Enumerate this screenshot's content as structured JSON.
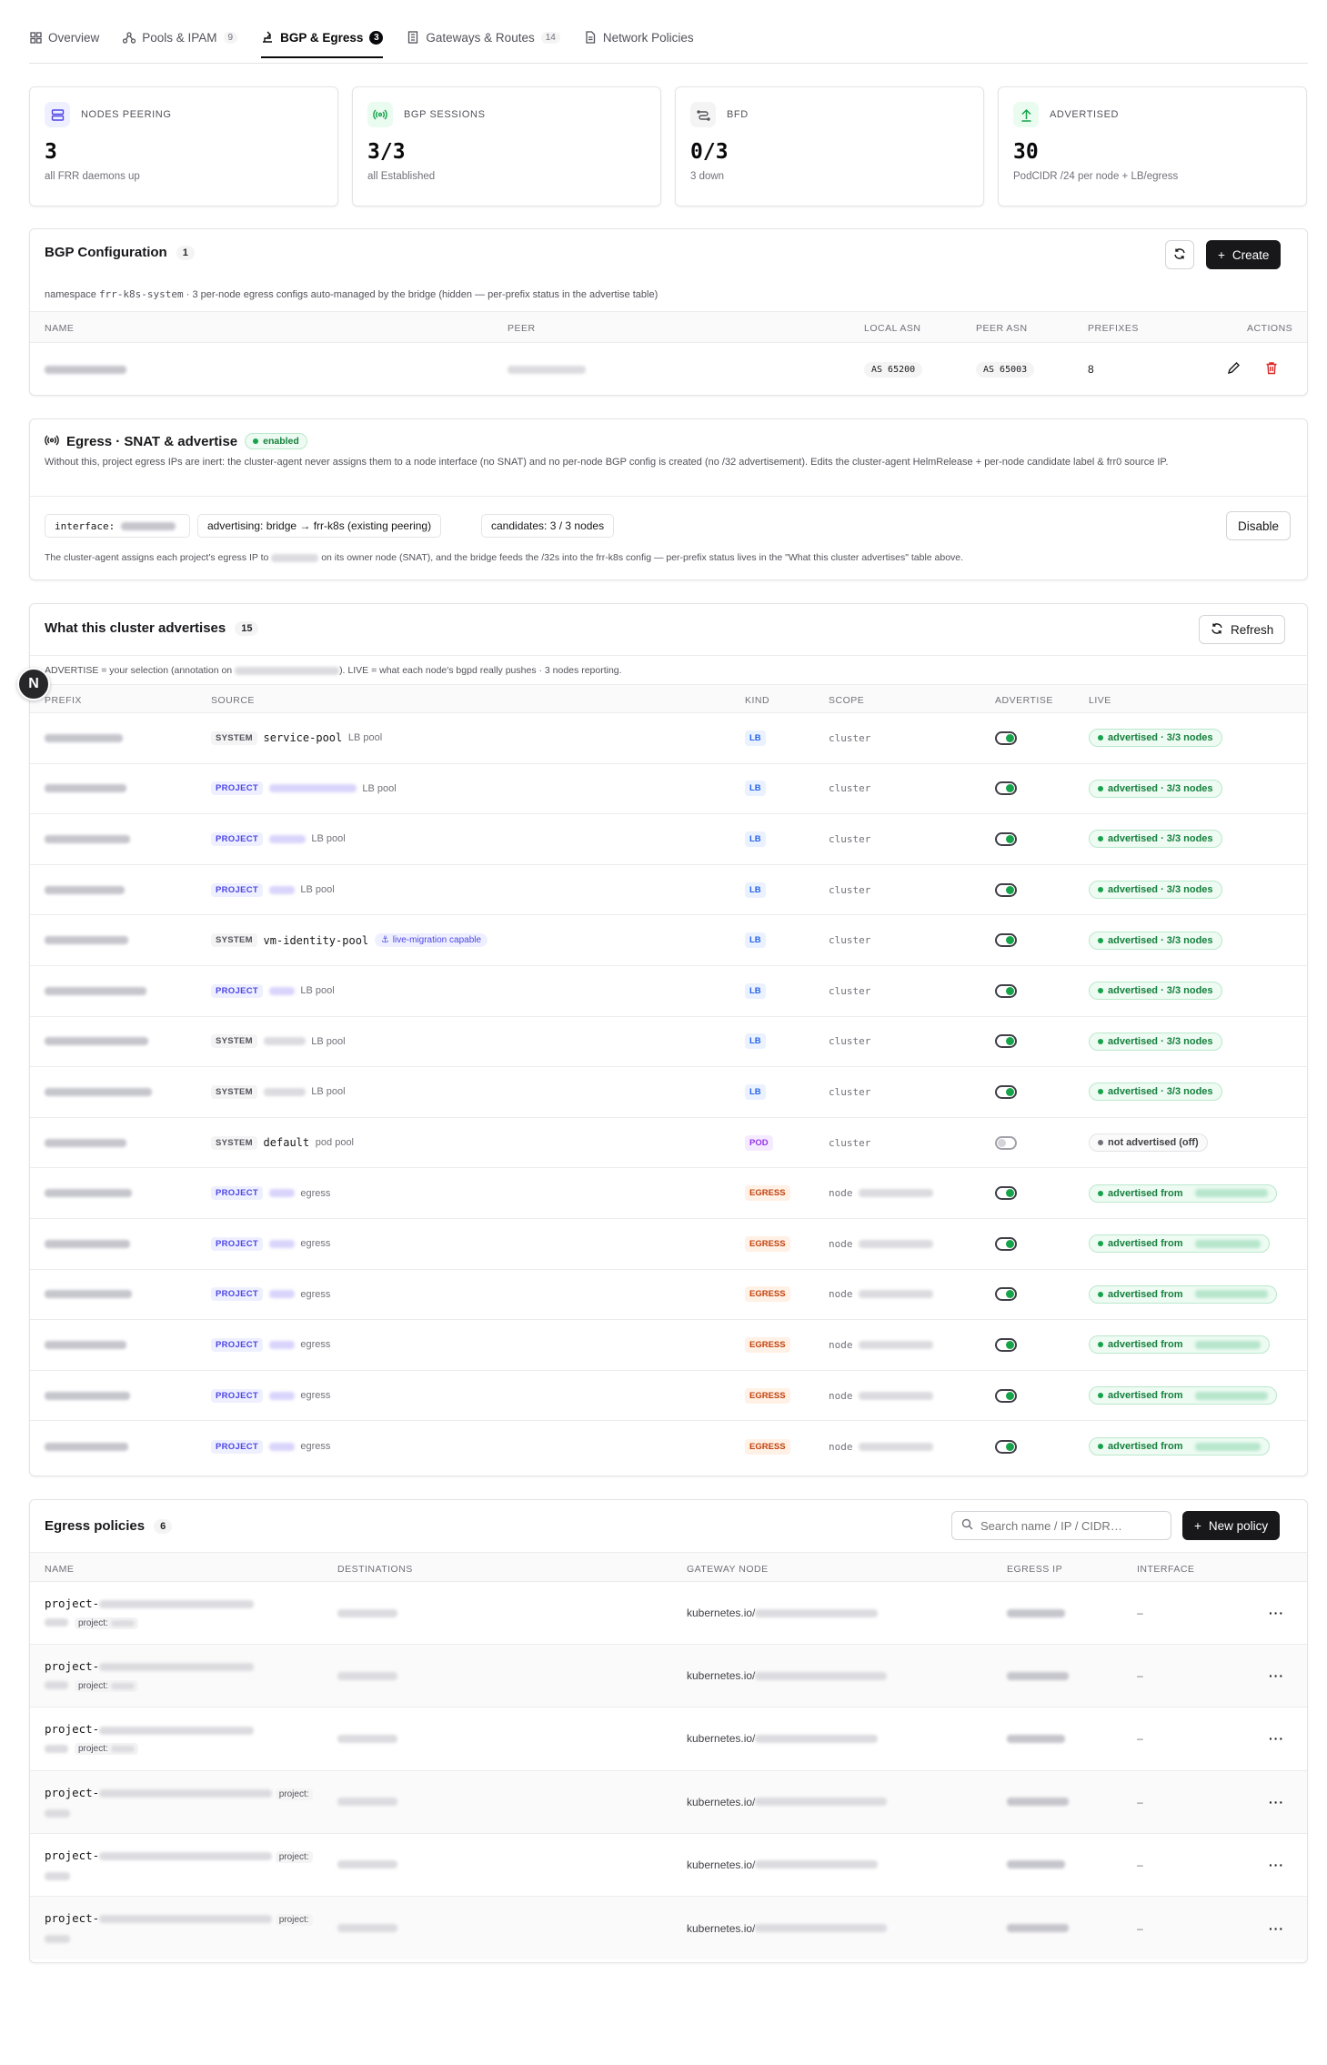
{
  "tabs": [
    {
      "label": "Overview",
      "icon": "grid-icon",
      "count": ""
    },
    {
      "label": "Pools & IPAM",
      "icon": "network-icon",
      "count": "9"
    },
    {
      "label": "BGP & Egress",
      "icon": "route-icon",
      "count": "3"
    },
    {
      "label": "Gateways & Routes",
      "icon": "gateway-icon",
      "count": "14"
    },
    {
      "label": "Network Policies",
      "icon": "document-icon",
      "count": ""
    }
  ],
  "stats": [
    {
      "label": "NODES PEERING",
      "value": "3",
      "sub": "all FRR daemons up",
      "icon": "server-icon",
      "color": "#4f46e5"
    },
    {
      "label": "BGP SESSIONS",
      "value": "3/3",
      "sub": "all Established",
      "icon": "radio-icon",
      "color": "#16a34a"
    },
    {
      "label": "BFD",
      "value": "0/3",
      "sub": "3 down",
      "icon": "link-icon",
      "color": "#52525b"
    },
    {
      "label": "ADVERTISED",
      "value": "30",
      "sub": "PodCIDR /24 per node + LB/egress",
      "icon": "upload-icon",
      "color": "#16a34a"
    }
  ],
  "bgp": {
    "title": "BGP Configuration",
    "count": "1",
    "create_label": "Create",
    "ns_prefix": "namespace",
    "ns_value": "frr-k8s-system",
    "ns_note": "· 3 per-node egress configs auto-managed by the bridge (hidden — per-prefix status in the advertise table)",
    "headers": {
      "name": "NAME",
      "peer": "PEER",
      "local_asn": "LOCAL ASN",
      "peer_asn": "PEER ASN",
      "prefixes": "PREFIXES",
      "actions": "ACTIONS"
    },
    "row": {
      "local_asn": "AS 65200",
      "peer_asn": "AS 65003",
      "prefixes": "8"
    }
  },
  "egress": {
    "title": "Egress · SNAT & advertise",
    "status": "enabled",
    "desc": "Without this, project egress IPs are inert: the cluster-agent never assigns them to a node interface (no SNAT) and no per-node BGP config is created (no /32 advertisement). Edits the cluster-agent HelmRelease + per-node candidate label & frr0 source IP.",
    "interface_label": "interface:",
    "advertising": "advertising: bridge → frr-k8s (existing peering)",
    "candidates": "candidates: 3 / 3 nodes",
    "disable_label": "Disable",
    "note_a": "The cluster-agent assigns each project's egress IP to",
    "note_b": "on its owner node (SNAT), and the bridge feeds the /32s into the frr-k8s config — per-prefix status lives in the \"What this cluster advertises\" table above."
  },
  "advertises": {
    "title": "What this cluster advertises",
    "count": "15",
    "refresh_label": "Refresh",
    "note_a": "ADVERTISE = your selection (annotation on",
    "note_b": "). LIVE = what each node's bgpd really pushes · 3 nodes reporting.",
    "headers": {
      "prefix": "PREFIX",
      "source": "SOURCE",
      "kind": "KIND",
      "scope": "SCOPE",
      "advertise": "ADVERTISE",
      "live": "LIVE"
    },
    "rows": [
      {
        "chip": "SYSTEM",
        "name": "service-pool",
        "suffix": "LB pool",
        "kind": "LB",
        "scope": "cluster",
        "on": true,
        "live": "advertised · 3/3 nodes"
      },
      {
        "chip": "PROJECT",
        "name": "",
        "suffix": "LB pool",
        "kind": "LB",
        "scope": "cluster",
        "on": true,
        "live": "advertised · 3/3 nodes"
      },
      {
        "chip": "PROJECT",
        "name": "",
        "suffix": "LB pool",
        "kind": "LB",
        "scope": "cluster",
        "on": true,
        "live": "advertised · 3/3 nodes"
      },
      {
        "chip": "PROJECT",
        "name": "",
        "suffix": "LB pool",
        "kind": "LB",
        "scope": "cluster",
        "on": true,
        "live": "advertised · 3/3 nodes"
      },
      {
        "chip": "SYSTEM",
        "name": "vm-identity-pool",
        "suffix": "",
        "badge": "live-migration capable",
        "kind": "LB",
        "scope": "cluster",
        "on": true,
        "live": "advertised · 3/3 nodes"
      },
      {
        "chip": "PROJECT",
        "name": "",
        "suffix": "LB pool",
        "kind": "LB",
        "scope": "cluster",
        "on": true,
        "live": "advertised · 3/3 nodes"
      },
      {
        "chip": "SYSTEM",
        "name": "",
        "suffix": "LB pool",
        "kind": "LB",
        "scope": "cluster",
        "on": true,
        "live": "advertised · 3/3 nodes"
      },
      {
        "chip": "SYSTEM",
        "name": "",
        "suffix": "LB pool",
        "kind": "LB",
        "scope": "cluster",
        "on": true,
        "live": "advertised · 3/3 nodes"
      },
      {
        "chip": "SYSTEM",
        "name": "default",
        "suffix": "pod pool",
        "kind": "POD",
        "scope": "cluster",
        "on": false,
        "live": "not advertised (off)"
      },
      {
        "chip": "PROJECT",
        "name": "",
        "suffix": "egress",
        "kind": "EGRESS",
        "scope": "node",
        "on": true,
        "live": "advertised from"
      },
      {
        "chip": "PROJECT",
        "name": "",
        "suffix": "egress",
        "kind": "EGRESS",
        "scope": "node",
        "on": true,
        "live": "advertised from"
      },
      {
        "chip": "PROJECT",
        "name": "",
        "suffix": "egress",
        "kind": "EGRESS",
        "scope": "node",
        "on": true,
        "live": "advertised from"
      },
      {
        "chip": "PROJECT",
        "name": "",
        "suffix": "egress",
        "kind": "EGRESS",
        "scope": "node",
        "on": true,
        "live": "advertised from"
      },
      {
        "chip": "PROJECT",
        "name": "",
        "suffix": "egress",
        "kind": "EGRESS",
        "scope": "node",
        "on": true,
        "live": "advertised from"
      },
      {
        "chip": "PROJECT",
        "name": "",
        "suffix": "egress",
        "kind": "EGRESS",
        "scope": "node",
        "on": true,
        "live": "advertised from"
      }
    ]
  },
  "policies": {
    "title": "Egress policies",
    "count": "6",
    "search_placeholder": "Search name / IP / CIDR…",
    "new_label": "New policy",
    "headers": {
      "name": "NAME",
      "destinations": "DESTINATIONS",
      "gateway": "GATEWAY NODE",
      "egress_ip": "EGRESS IP",
      "interface": "INTERFACE"
    },
    "rows": [
      {
        "name": "project-",
        "project": "project:",
        "gateway": "kubernetes.io/",
        "interface": "–"
      },
      {
        "name": "project-",
        "project": "project:",
        "gateway": "kubernetes.io/",
        "interface": "–"
      },
      {
        "name": "project-",
        "project": "project:",
        "gateway": "kubernetes.io/",
        "interface": "–"
      },
      {
        "name": "project-",
        "project": "project:",
        "gateway": "kubernetes.io/",
        "interface": "–"
      },
      {
        "name": "project-",
        "project": "project:",
        "gateway": "kubernetes.io/",
        "interface": "–"
      },
      {
        "name": "project-",
        "project": "project:",
        "gateway": "kubernetes.io/",
        "interface": "–"
      }
    ]
  },
  "avatar_letter": "N"
}
